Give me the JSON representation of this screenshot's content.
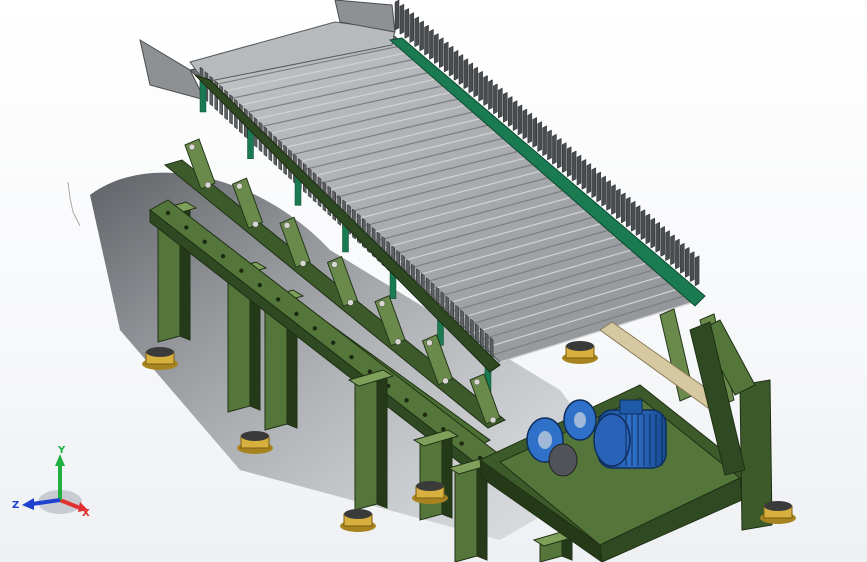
{
  "triad": {
    "x_label": "X",
    "y_label": "Y",
    "z_label": "Z",
    "x_color": "#e03030",
    "y_color": "#20b040",
    "z_color": "#2040d0"
  },
  "colors": {
    "frame_green": "#3c5a2a",
    "frame_green_light": "#55763a",
    "frame_green_dark": "#243a18",
    "pan_gray": "#9a9da0",
    "fin_dark": "#4a4d50",
    "belt_green": "#1a7a52",
    "motor_blue": "#1f5aa8",
    "foot_yellow": "#d8b040",
    "shaft_tan": "#d6c8a0"
  }
}
